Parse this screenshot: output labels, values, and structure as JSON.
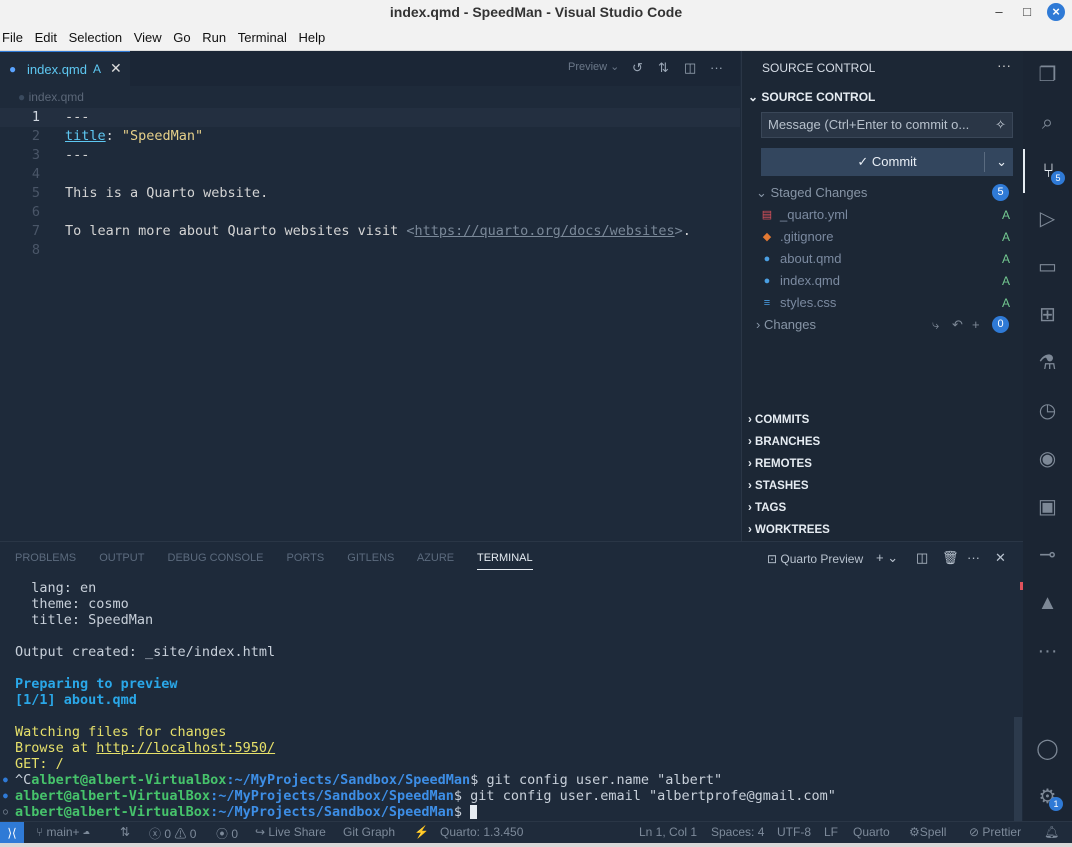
{
  "window": {
    "title": "index.qmd - SpeedMan - Visual Studio Code"
  },
  "menu": [
    "File",
    "Edit",
    "Selection",
    "View",
    "Go",
    "Run",
    "Terminal",
    "Help"
  ],
  "tab": {
    "name": "index.qmd",
    "status": "A",
    "preview_label": "Preview"
  },
  "breadcrumb": "index.qmd",
  "code_lines": [
    {
      "n": "1",
      "text": "---"
    },
    {
      "n": "2",
      "text": "title: \"SpeedMan\""
    },
    {
      "n": "3",
      "text": "---"
    },
    {
      "n": "4",
      "text": ""
    },
    {
      "n": "5",
      "text": "This is a Quarto website."
    },
    {
      "n": "6",
      "text": ""
    },
    {
      "n": "7",
      "text": "To learn more about Quarto websites visit <https://quarto.org/docs/websites>."
    },
    {
      "n": "8",
      "text": ""
    }
  ],
  "source_control": {
    "header": "SOURCE CONTROL",
    "section": "SOURCE CONTROL",
    "message_placeholder": "Message (Ctrl+Enter to commit o...",
    "commit_label": "Commit",
    "staged_label": "Staged Changes",
    "staged_count": "5",
    "staged_files": [
      {
        "name": "_quarto.yml",
        "status": "A",
        "icon_color": "#e0525c"
      },
      {
        "name": ".gitignore",
        "status": "A",
        "icon_color": "#e37933"
      },
      {
        "name": "about.qmd",
        "status": "A",
        "icon_color": "#4a9fe3"
      },
      {
        "name": "index.qmd",
        "status": "A",
        "icon_color": "#4a9fe3"
      },
      {
        "name": "styles.css",
        "status": "A",
        "icon_color": "#4a9fe3"
      }
    ],
    "changes_label": "Changes",
    "changes_count": "0",
    "sections": [
      "COMMITS",
      "BRANCHES",
      "REMOTES",
      "STASHES",
      "TAGS",
      "WORKTREES"
    ]
  },
  "activity_badges": {
    "scm": "5",
    "accounts": "1"
  },
  "panel": {
    "tabs": [
      "PROBLEMS",
      "OUTPUT",
      "DEBUG CONSOLE",
      "PORTS",
      "GITLENS",
      "AZURE",
      "TERMINAL"
    ],
    "active_tab": "TERMINAL",
    "terminal_name": "Quarto Preview"
  },
  "terminal": {
    "lang": "  lang: en",
    "theme": "  theme: cosmo",
    "title": "  title: SpeedMan",
    "output": "Output created: _site/index.html",
    "preparing": "Preparing to preview",
    "progress": "[1/1] about.qmd",
    "watching": "Watching files for changes",
    "browse_prefix": "Browse at ",
    "browse_url": "http://localhost:5950/",
    "get": "GET: /",
    "prompt1_prefix": "^C",
    "user_host": "albert@albert-VirtualBox",
    "path": ":~/MyProjects/Sandbox/SpeedMan",
    "cmd1": "$ git config user.name \"albert\"",
    "cmd2": "$ git config user.email \"albertprofe@gmail.com\"",
    "cmd3": "$ "
  },
  "status": {
    "branch": "main+",
    "errors": "0",
    "warnings": "0",
    "ports": "0",
    "live_share": "Live Share",
    "git_graph": "Git Graph",
    "quarto_version": "Quarto: 1.3.450",
    "position": "Ln 1, Col 1",
    "spaces": "Spaces: 4",
    "encoding": "UTF-8",
    "eol": "LF",
    "language": "Quarto",
    "spell": "Spell",
    "prettier": "Prettier"
  }
}
